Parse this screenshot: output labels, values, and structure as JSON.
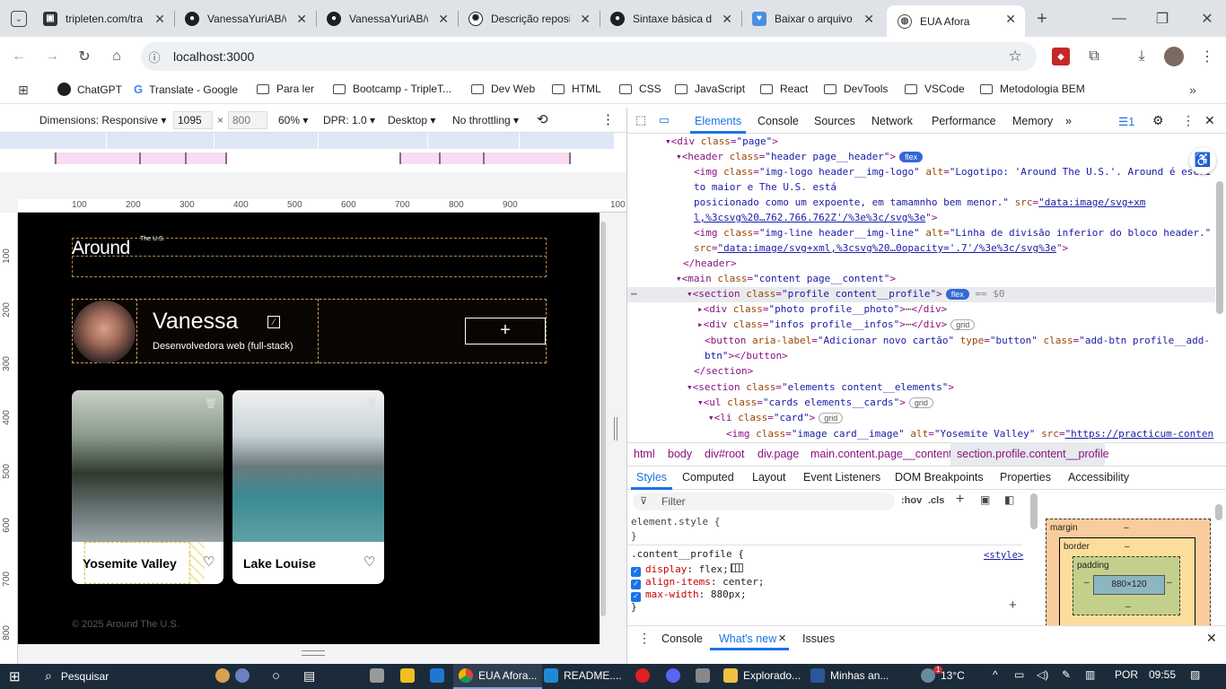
{
  "tabs": [
    {
      "title": "tripleten.com/tra",
      "icon": "tripleten-favicon"
    },
    {
      "title": "VanessaYuriAB/w",
      "icon": "github-favicon"
    },
    {
      "title": "VanessaYuriAB/w",
      "icon": "github-favicon"
    },
    {
      "title": "Descrição reposi",
      "icon": "openai-favicon"
    },
    {
      "title": "Sintaxe básica de",
      "icon": "github-favicon"
    },
    {
      "title": "Baixar o arquivo",
      "icon": "heart-favicon"
    },
    {
      "title": "EUA Afora",
      "icon": "globe-favicon"
    }
  ],
  "toolbar": {
    "url": "localhost:3000"
  },
  "bookmarks": [
    {
      "label": "ChatGPT",
      "icon": "openai-icon"
    },
    {
      "label": "Translate - Google",
      "icon": "google-icon"
    },
    {
      "label": "Para ler",
      "icon": "folder-icon"
    },
    {
      "label": "Bootcamp - TripleT...",
      "icon": "folder-icon"
    },
    {
      "label": "Dev Web",
      "icon": "folder-icon"
    },
    {
      "label": "HTML",
      "icon": "folder-icon"
    },
    {
      "label": "CSS",
      "icon": "folder-icon"
    },
    {
      "label": "JavaScript",
      "icon": "folder-icon"
    },
    {
      "label": "React",
      "icon": "folder-icon"
    },
    {
      "label": "DevTools",
      "icon": "folder-icon"
    },
    {
      "label": "VSCode",
      "icon": "folder-icon"
    },
    {
      "label": "Metodologia BEM",
      "icon": "folder-icon"
    }
  ],
  "device": {
    "dimensions": "Dimensions: Responsive",
    "width": "1095",
    "x": "×",
    "height": "800",
    "zoom": "60%",
    "dpr": "DPR: 1.0",
    "mode": "Desktop",
    "throttle": "No throttling"
  },
  "ruler": {
    "h": [
      "100",
      "200",
      "300",
      "400",
      "500",
      "600",
      "700",
      "800",
      "900",
      "100"
    ],
    "v": [
      "100",
      "200",
      "300",
      "400",
      "500",
      "600",
      "700",
      "800"
    ]
  },
  "site": {
    "logo_main": "Around",
    "logo_sub": "The U.S.",
    "profile_name": "Vanessa",
    "profile_job": "Desenvolvedora web (full-stack)",
    "add_symbol": "+",
    "cards": [
      {
        "title": "Yosemite Valley"
      },
      {
        "title": "Lake Louise"
      }
    ],
    "footer": "© 2025 Around The U.S."
  },
  "devtools": {
    "tabs": [
      "Elements",
      "Console",
      "Sources",
      "Network",
      "Performance",
      "Memory"
    ],
    "issues_count": "1",
    "crumbs": [
      "html",
      "body",
      "div#root",
      "div.page",
      "main.content.page__content",
      "section.profile.content__profile"
    ],
    "pane_tabs": [
      "Styles",
      "Computed",
      "Layout",
      "Event Listeners",
      "DOM Breakpoints",
      "Properties",
      "Accessibility"
    ],
    "filter_placeholder": "Filter",
    "hov": ":hov",
    "cls": ".cls",
    "style_source": "<style>",
    "box": {
      "margin": "margin",
      "border": "border",
      "padding": "padding",
      "dash": "–",
      "content": "880×120"
    },
    "drawer": [
      "Console",
      "What's new",
      "Issues"
    ]
  },
  "taskbar": {
    "search": "Pesquisar",
    "apps": [
      "EUA Afora...",
      "README....",
      "Explorado...",
      "Minhas an..."
    ],
    "weather": "13°C",
    "lang": "POR",
    "time": "09:55",
    "weather_badge": "1"
  },
  "colors": {
    "chrome_tabbar": "#dfe3e7",
    "devtools_accent": "#1a73e8",
    "site_bg": "#000000",
    "taskbar": "#1c2b3a"
  }
}
